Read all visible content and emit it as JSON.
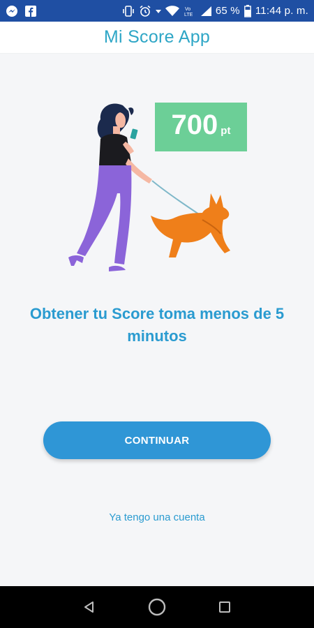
{
  "status_bar": {
    "battery_percent": "65 %",
    "time": "11:44 p. m.",
    "icons": [
      "messenger-icon",
      "facebook-icon",
      "vibrate-icon",
      "alarm-icon",
      "wifi-icon",
      "volte-icon",
      "signal-icon",
      "battery-icon"
    ]
  },
  "header": {
    "title": "Mi Score App"
  },
  "hero": {
    "score_value": "700",
    "score_unit": "pt",
    "illustration": "woman-walking-dog"
  },
  "headline": "Obtener tu Score toma menos de 5 minutos",
  "actions": {
    "continue_label": "CONTINUAR",
    "existing_account_label": "Ya tengo una cuenta"
  },
  "nav": {
    "icons": [
      "back-icon",
      "home-icon",
      "recents-icon"
    ]
  },
  "colors": {
    "status_bar": "#1f4fa3",
    "title": "#2ea6c6",
    "accent": "#2a9bd0",
    "button": "#2f96d6",
    "badge": "#6ccf97",
    "dog": "#ef7f1a",
    "pants": "#8b64d9"
  }
}
